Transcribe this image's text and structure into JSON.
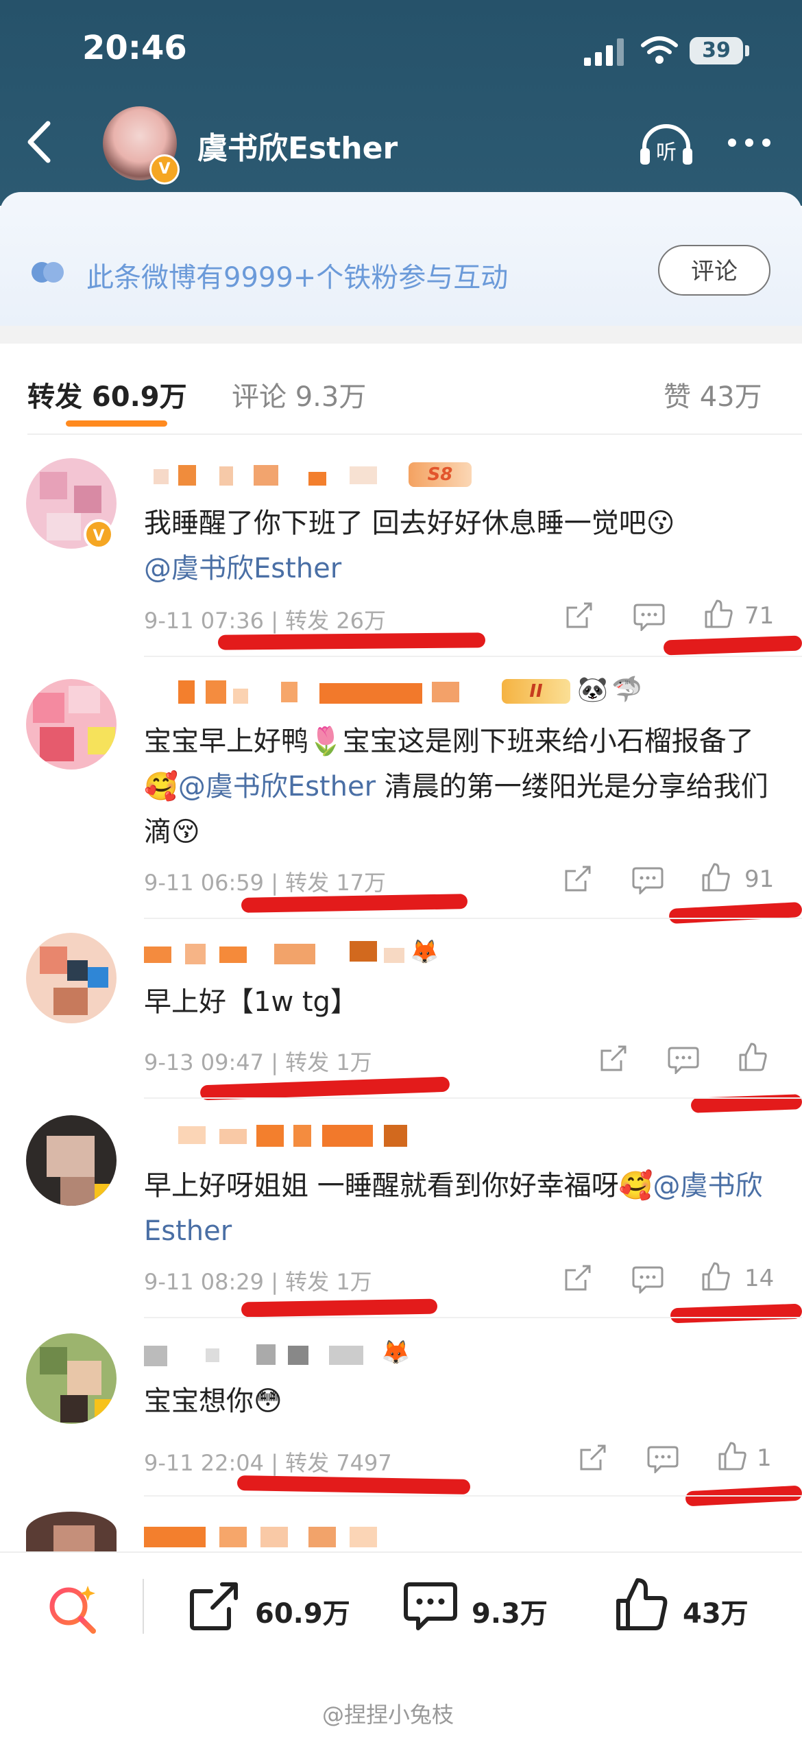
{
  "status": {
    "time": "20:46",
    "battery": "39"
  },
  "header": {
    "title": "虞书欣Esther"
  },
  "banner": {
    "text": "此条微博有9999+个铁粉参与互动",
    "button": "评论"
  },
  "tabs": {
    "repost": "转发 60.9万",
    "comment": "评论 9.3万",
    "like": "赞 43万"
  },
  "comments": [
    {
      "badge": "S8",
      "text_main": "我睡醒了你下班了 回去好好休息睡一觉吧😗",
      "mention": "@虞书欣Esther",
      "meta": "9-11 07:36 | 转发 26万",
      "likes": "71"
    },
    {
      "badge": "II",
      "text_before": "宝宝早上好鸭🌷宝宝这是刚下班来给小石榴报备了🥰",
      "mention": "@虞书欣Esther",
      "text_after": " 清晨的第一缕阳光是分享给我们滴😚",
      "meta": "9-11 06:59 | 转发 17万",
      "likes": "91"
    },
    {
      "text_main": "早上好【1w tg】",
      "meta": "9-13 09:47 | 转发 1万",
      "likes": ""
    },
    {
      "text_main": "早上好呀姐姐 一睡醒就看到你好幸福呀🥰",
      "mention": "@虞书欣Esther",
      "meta": "9-11 08:29 | 转发 1万",
      "likes": "14"
    },
    {
      "text_main": "宝宝想你😳",
      "meta": "9-11 22:04 | 转发 7497",
      "likes": "1"
    }
  ],
  "bottom": {
    "repost": "60.9万",
    "comment": "9.3万",
    "like": "43万"
  },
  "watermark": "@捏捏小兔枝",
  "colors": {
    "header": "#2c5a72",
    "accent_orange": "#ff8a1f",
    "mention": "#4a6fa5",
    "red_mark": "#e31b1b",
    "banner_text": "#6b9ad9"
  }
}
